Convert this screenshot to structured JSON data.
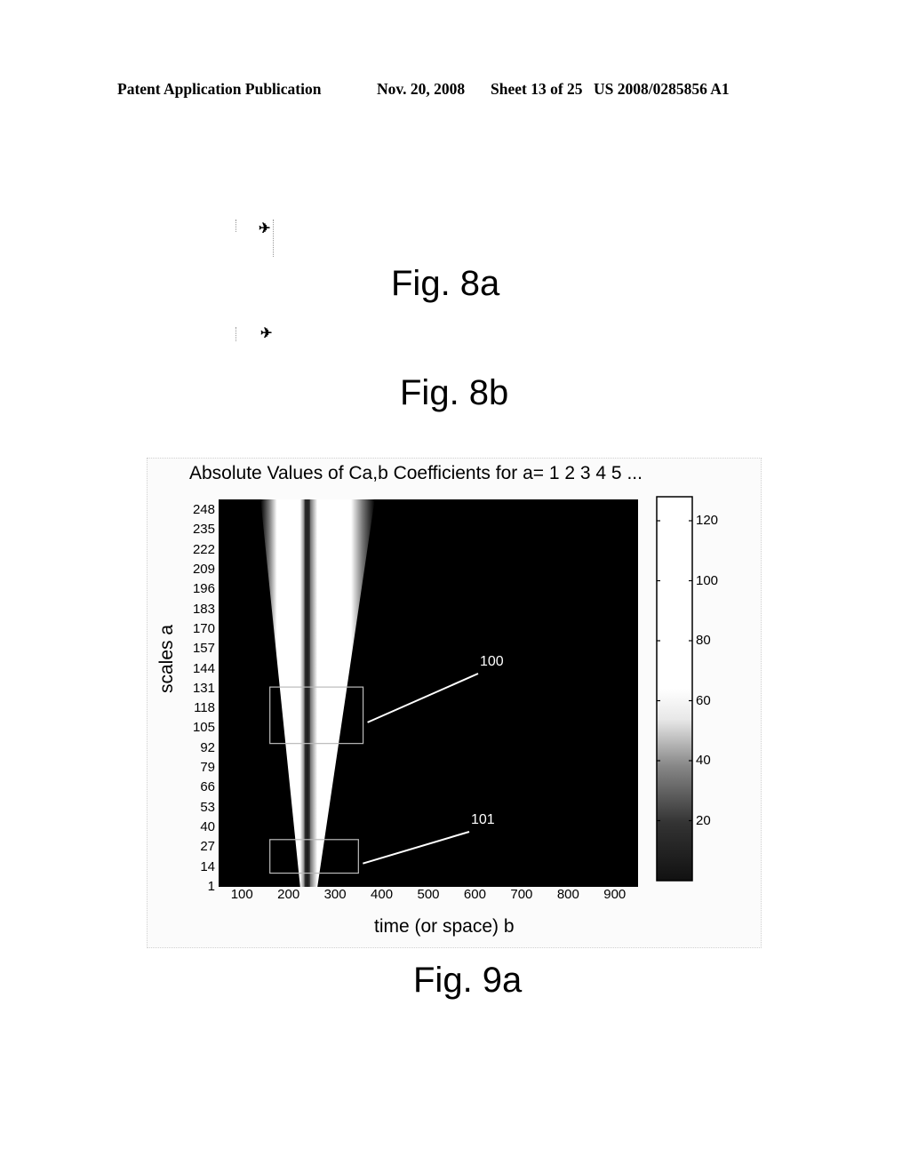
{
  "header": {
    "publication": "Patent Application Publication",
    "date": "Nov. 20, 2008",
    "sheet": "Sheet 13 of 25",
    "number": "US 2008/0285856 A1"
  },
  "figures": {
    "fig8a": {
      "label": "Fig. 8a",
      "icon": "aircraft-silhouette-icon"
    },
    "fig8b": {
      "label": "Fig. 8b",
      "icon": "aircraft-silhouette-icon"
    },
    "fig9a": {
      "label": "Fig. 9a"
    }
  },
  "chart_data": {
    "type": "heatmap",
    "title": "Absolute Values of Ca,b Coefficients for a= 1 2 3 4 5 ...",
    "xlabel": "time (or space) b",
    "ylabel": "scales a",
    "x_ticks": [
      "100",
      "200",
      "300",
      "400",
      "500",
      "600",
      "700",
      "800",
      "900"
    ],
    "y_ticks": [
      "248",
      "235",
      "222",
      "209",
      "196",
      "183",
      "170",
      "157",
      "144",
      "131",
      "118",
      "105",
      "92",
      "79",
      "66",
      "53",
      "40",
      "27",
      "14",
      "1"
    ],
    "xlim": [
      50,
      950
    ],
    "ylim": [
      1,
      255
    ],
    "colormap": "gray",
    "colorbar": {
      "ticks": [
        "120",
        "100",
        "80",
        "60",
        "40",
        "20"
      ],
      "range": [
        0,
        128
      ]
    },
    "description": "Two cone-shaped bright regions diverging upward from b≈230 at small scales, centered near b≈220 and b≈260, widening to span b≈150–380 at the largest scales; background near zero (black).",
    "annotations": [
      {
        "label": "100",
        "box_b": [
          160,
          360
        ],
        "box_a": [
          95,
          132
        ]
      },
      {
        "label": "101",
        "box_b": [
          160,
          350
        ],
        "box_a": [
          10,
          32
        ]
      }
    ]
  }
}
